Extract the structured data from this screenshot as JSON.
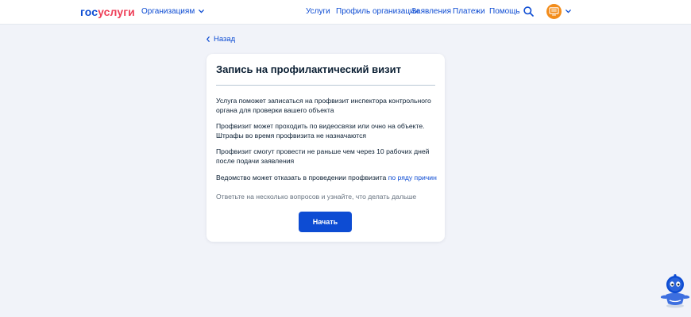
{
  "header": {
    "logo_part1": "гос",
    "logo_part2": "услуги",
    "org_menu_label": "Организациям",
    "nav": [
      "Услуги",
      "Профиль организации",
      "Заявления",
      "Платежи",
      "Помощь"
    ]
  },
  "back_link": "Назад",
  "card": {
    "title": "Запись на профилактический визит",
    "paragraphs": [
      "Услуга поможет записаться на профвизит инспектора контрольного органа для проверки вашего объекта",
      "Профвизит может проходить по видеосвязи или очно на объекте. Штрафы во время профвизита не назначаются",
      "Профвизит смогут провести не раньше чем через 10 рабочих дней после подачи заявления"
    ],
    "refusal_text": "Ведомство может отказать в проведении профвизита",
    "refusal_link": "по ряду причин",
    "hint": "Ответьте на несколько вопросов и узнайте, что делать дальше",
    "start_button": "Начать"
  },
  "colors": {
    "brand_blue": "#0d4cd3",
    "brand_red": "#ee3f58",
    "page_bg": "#f1f3f9",
    "avatar_orange": "#f28c1b"
  },
  "icons": {
    "org_chevron": "chevron-down-icon",
    "search": "search-icon",
    "avatar": "user-avatar-icon",
    "back": "chevron-left-icon",
    "assistant": "robot-assistant-icon"
  }
}
